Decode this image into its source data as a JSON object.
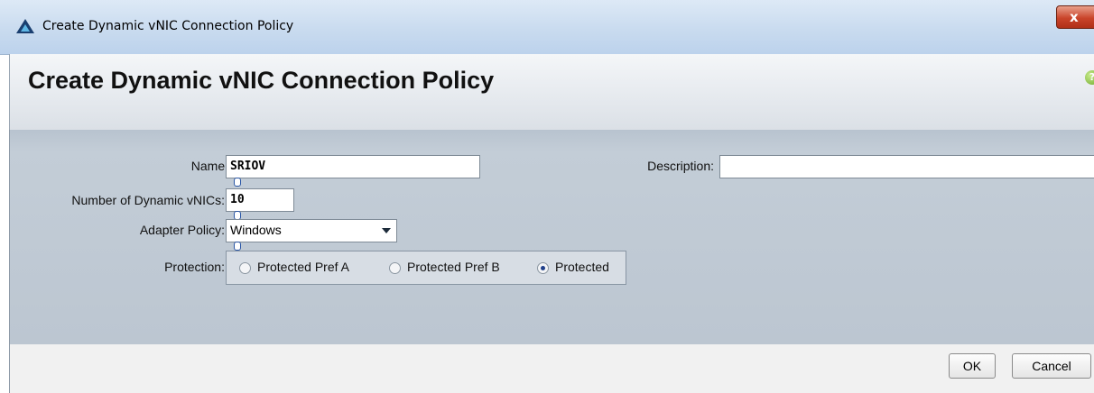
{
  "window": {
    "title": "Create Dynamic vNIC Connection Policy",
    "close_label": "x"
  },
  "header": {
    "title": "Create Dynamic vNIC Connection Policy",
    "help_label": "?"
  },
  "form": {
    "name": {
      "label": "Name:",
      "value": "SRIOV"
    },
    "description": {
      "label": "Description:",
      "value": ""
    },
    "dynamic_vnics": {
      "label": "Number of Dynamic vNICs:",
      "value": "10"
    },
    "adapter_policy": {
      "label": "Adapter Policy:",
      "value": "Windows"
    },
    "protection": {
      "label": "Protection:",
      "options": [
        {
          "label": "Protected Pref A",
          "selected": false
        },
        {
          "label": "Protected Pref B",
          "selected": false
        },
        {
          "label": "Protected",
          "selected": true
        }
      ]
    }
  },
  "footer": {
    "ok_label": "OK",
    "cancel_label": "Cancel"
  }
}
